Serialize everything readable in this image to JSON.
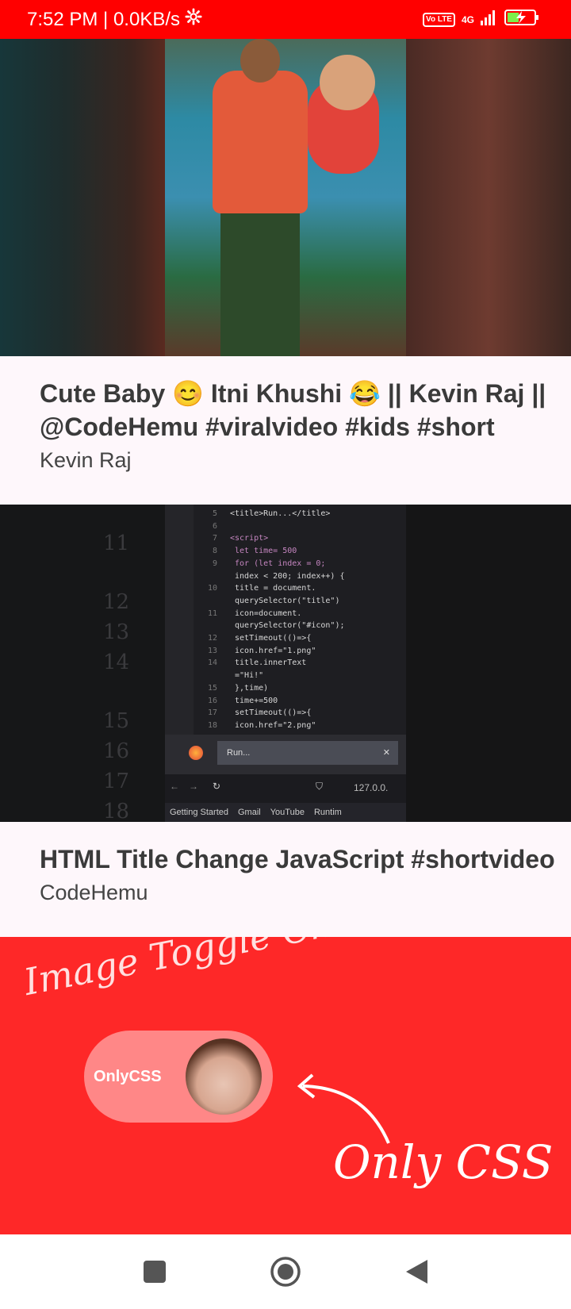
{
  "status_bar": {
    "time_speed": "7:52 PM | 0.0KB/s",
    "lte": "Vo LTE",
    "network": "4G",
    "background_color": "#ff0000"
  },
  "feed": {
    "items": [
      {
        "title": "Cute Baby 😊 Itni Khushi 😂 || Kevin Raj || @CodeHemu #viralvideo #kids #short",
        "channel": "Kevin Raj"
      },
      {
        "title": "HTML Title Change JavaScript #shortvideo",
        "channel": "CodeHemu",
        "thumbnail": {
          "code_lines": [
            {
              "n": "5",
              "text": "<title>Run...</title>"
            },
            {
              "n": "6",
              "text": ""
            },
            {
              "n": "7",
              "text": "<script>"
            },
            {
              "n": "8",
              "text": "  let time= 500"
            },
            {
              "n": "9",
              "text": "  for (let index = 0;"
            },
            {
              "n": "",
              "text": "  index < 200; index++) {"
            },
            {
              "n": "10",
              "text": "    title = document."
            },
            {
              "n": "",
              "text": "    querySelector(\"title\")"
            },
            {
              "n": "11",
              "text": "    icon=document."
            },
            {
              "n": "",
              "text": "    querySelector(\"#icon\");"
            },
            {
              "n": "12",
              "text": "    setTimeout(()=>{"
            },
            {
              "n": "13",
              "text": "      icon.href=\"1.png\""
            },
            {
              "n": "14",
              "text": "      title.innerText"
            },
            {
              "n": "",
              "text": "      =\"Hi!\""
            },
            {
              "n": "15",
              "text": "    },time)"
            },
            {
              "n": "16",
              "text": "    time+=500"
            },
            {
              "n": "17",
              "text": "    setTimeout(()=>{"
            },
            {
              "n": "18",
              "text": "      icon.href=\"2.png\""
            }
          ],
          "tab_label": "Run...",
          "url": "127.0.0.",
          "bookmarks": [
            "Getting Started",
            "Gmail",
            "YouTube",
            "Runtim"
          ],
          "big_numbers": [
            "11",
            "12",
            "13",
            "14",
            "15",
            "16",
            "17",
            "18"
          ]
        }
      },
      {
        "title": "",
        "channel": "",
        "thumbnail": {
          "heading": "Image Toggle Checkbox",
          "toggle_label": "OnlyCSS",
          "footer_text": "Only CSS",
          "background_color": "#fe2828"
        }
      }
    ]
  },
  "nav_bar": {
    "recents": "recents-button",
    "home": "home-button",
    "back": "back-button"
  }
}
